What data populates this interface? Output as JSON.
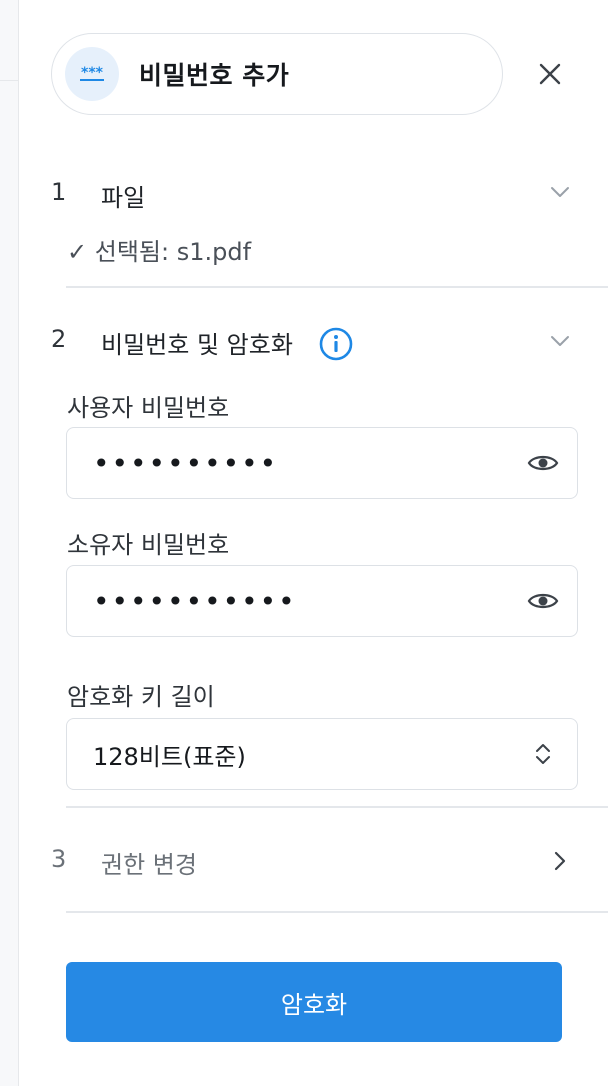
{
  "header": {
    "title": "비밀번호 추가",
    "icon": "password-icon",
    "close_icon": "close-icon"
  },
  "steps": [
    {
      "number": "1",
      "title": "파일",
      "status": "✓ 선택됨: s1.pdf",
      "expanded": true
    },
    {
      "number": "2",
      "title": "비밀번호 및 암호화",
      "info_icon": "info-icon",
      "expanded": true,
      "fields": {
        "user_password_label": "사용자 비밀번호",
        "user_password_value": "••••••••••",
        "owner_password_label": "소유자 비밀번호",
        "owner_password_value": "•••••••••••",
        "key_length_label": "암호화 키 길이",
        "key_length_value": "128비트(표준)"
      }
    },
    {
      "number": "3",
      "title": "권한 변경",
      "expanded": false
    }
  ],
  "actions": {
    "encrypt_label": "암호화"
  },
  "colors": {
    "accent": "#2689e4",
    "info_icon": "#1e88e5",
    "icon_bg": "#e6f0fb"
  }
}
